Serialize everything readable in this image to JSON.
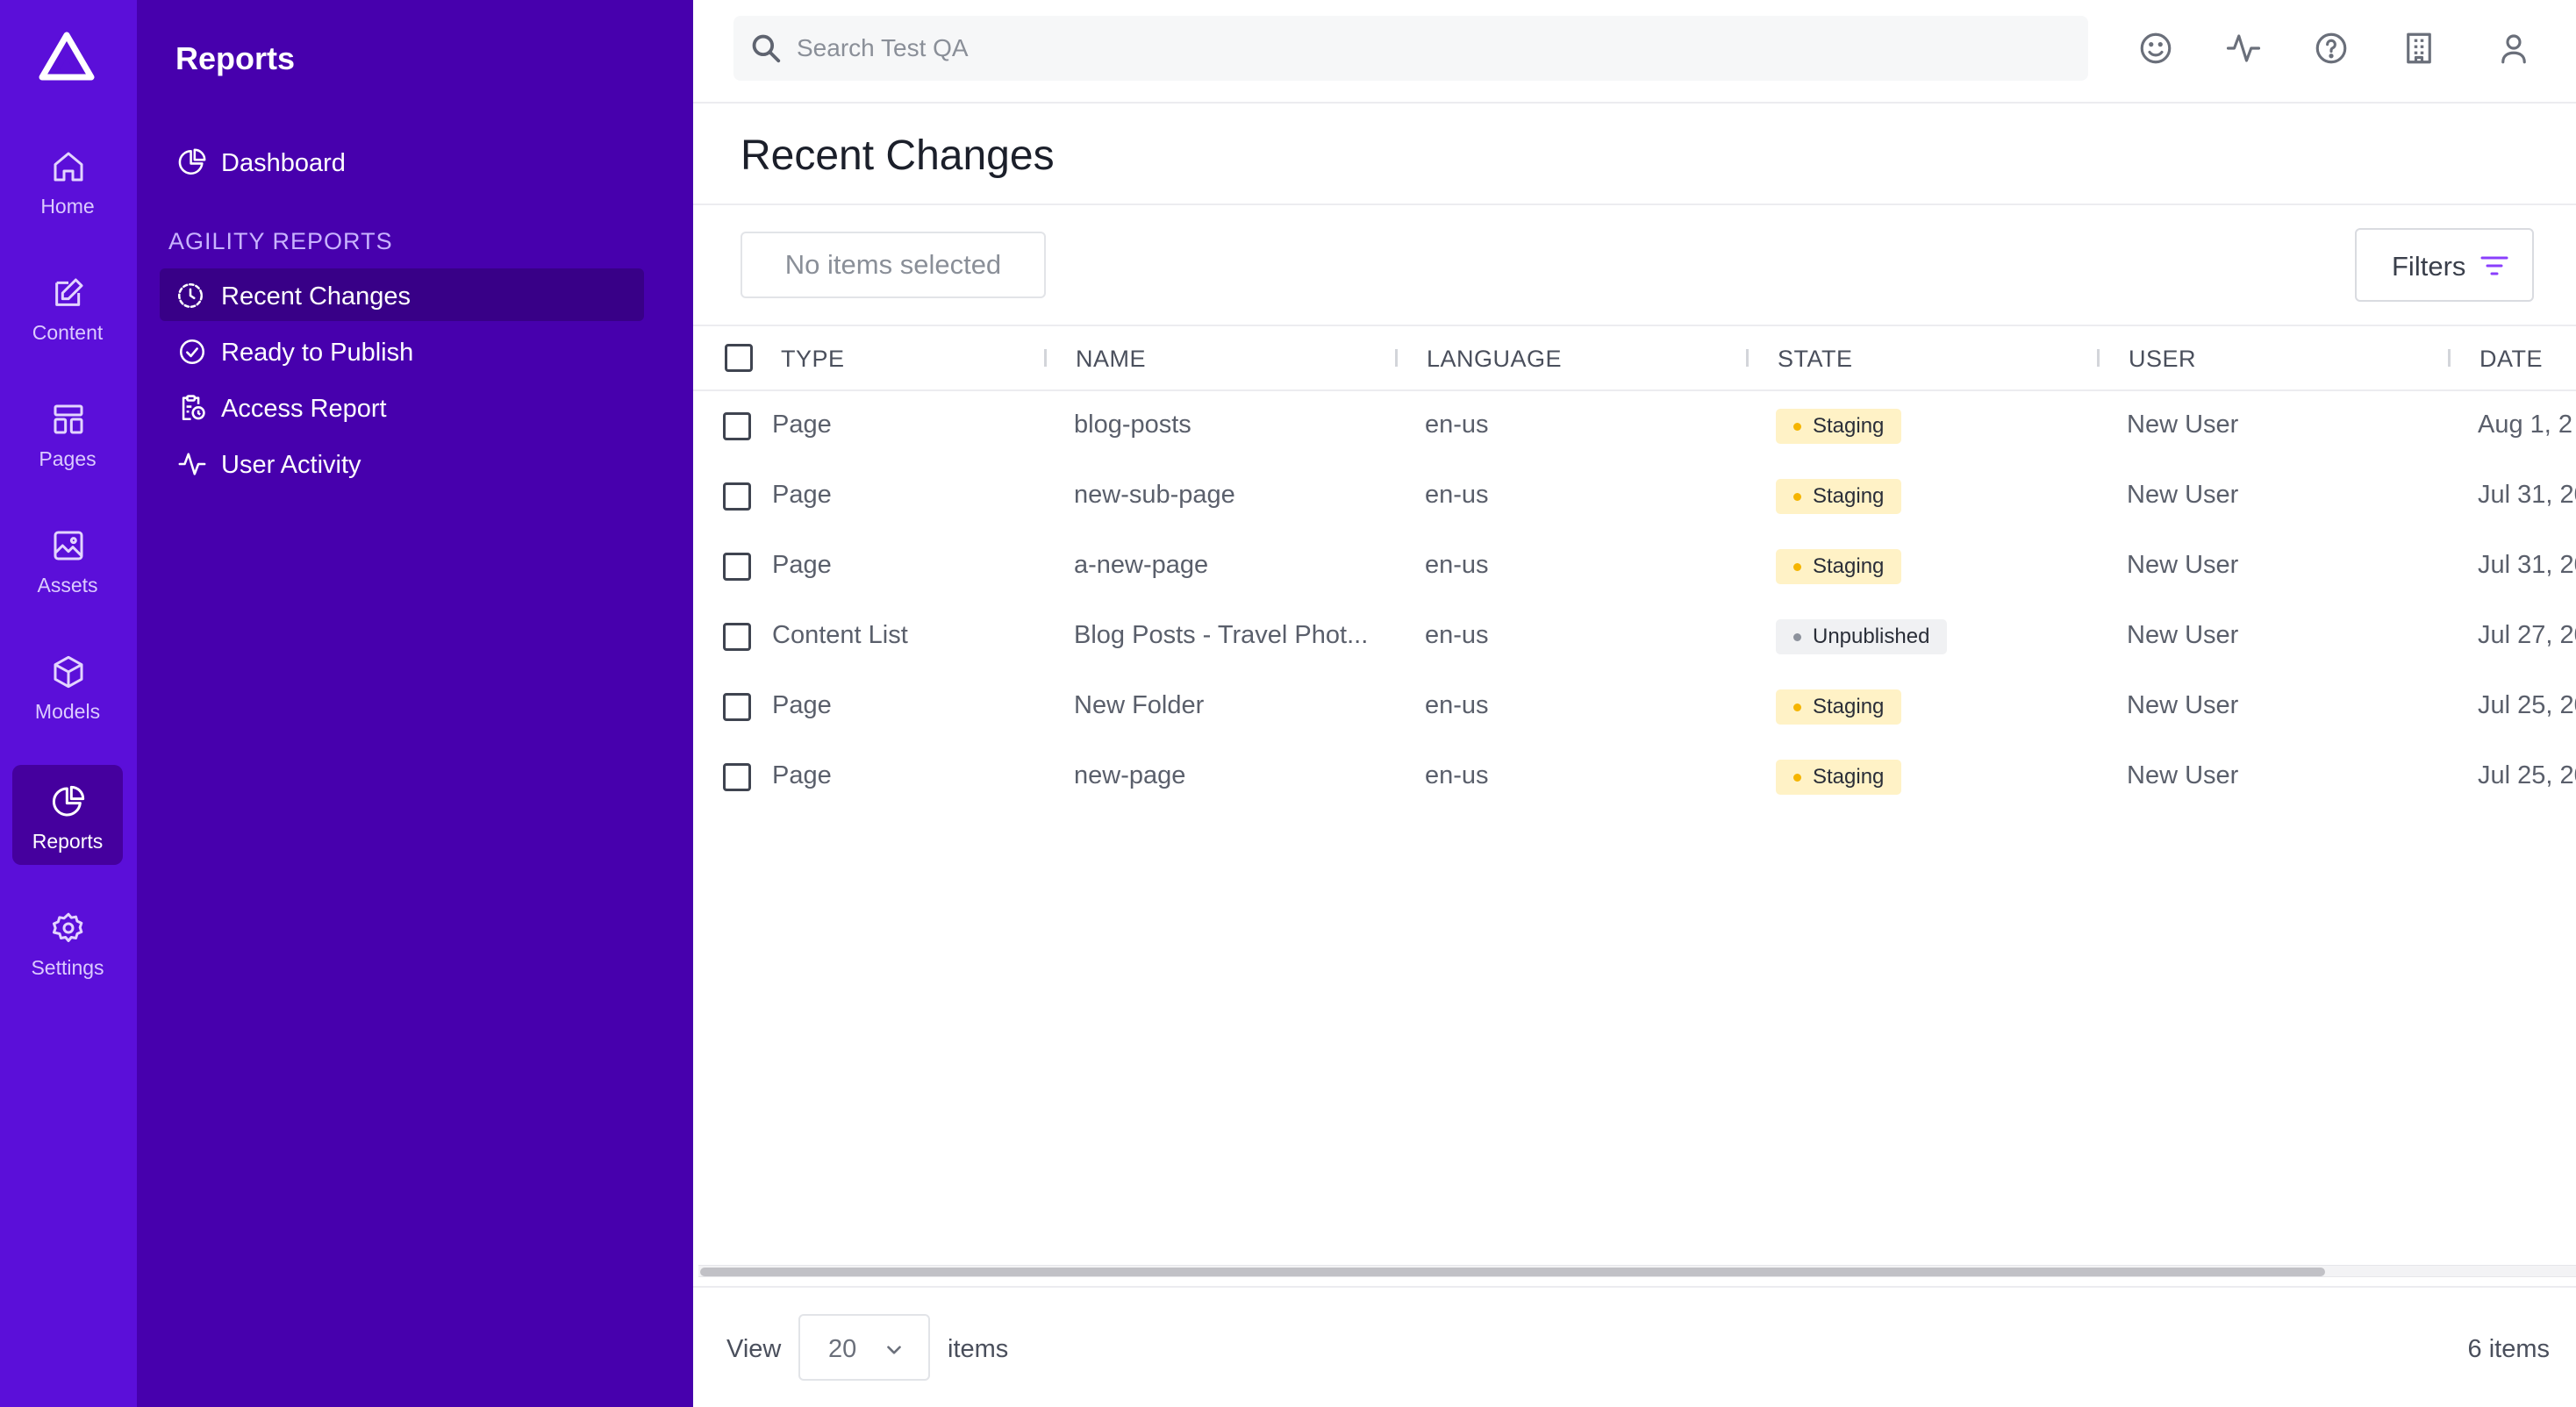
{
  "nav_rail": {
    "items": [
      {
        "label": "Home",
        "icon": "home-icon"
      },
      {
        "label": "Content",
        "icon": "edit-icon"
      },
      {
        "label": "Pages",
        "icon": "layout-icon"
      },
      {
        "label": "Assets",
        "icon": "image-icon"
      },
      {
        "label": "Models",
        "icon": "cube-icon"
      },
      {
        "label": "Reports",
        "icon": "pie-chart-icon",
        "active": true
      },
      {
        "label": "Settings",
        "icon": "gear-icon"
      }
    ]
  },
  "sidebar": {
    "title": "Reports",
    "dashboard": {
      "label": "Dashboard",
      "icon": "pie-chart-icon"
    },
    "section_label": "AGILITY REPORTS",
    "items": [
      {
        "label": "Recent Changes",
        "icon": "clock-dashed-icon",
        "active": true
      },
      {
        "label": "Ready to Publish",
        "icon": "check-circle-icon"
      },
      {
        "label": "Access Report",
        "icon": "clipboard-clock-icon"
      },
      {
        "label": "User Activity",
        "icon": "activity-icon"
      }
    ]
  },
  "topbar": {
    "search_placeholder": "Search Test QA",
    "icons": [
      "smile-icon",
      "activity-icon",
      "help-icon",
      "building-icon",
      "user-icon"
    ]
  },
  "page": {
    "title": "Recent Changes",
    "selection_text": "No items selected",
    "filters_label": "Filters"
  },
  "table": {
    "columns": [
      "TYPE",
      "NAME",
      "LANGUAGE",
      "STATE",
      "USER",
      "DATE"
    ],
    "rows": [
      {
        "type": "Page",
        "name": "blog-posts",
        "language": "en-us",
        "state": "Staging",
        "user": "New User",
        "date": "Aug 1, 2"
      },
      {
        "type": "Page",
        "name": "new-sub-page",
        "language": "en-us",
        "state": "Staging",
        "user": "New User",
        "date": "Jul 31, 20"
      },
      {
        "type": "Page",
        "name": "a-new-page",
        "language": "en-us",
        "state": "Staging",
        "user": "New User",
        "date": "Jul 31, 20"
      },
      {
        "type": "Content List",
        "name": "Blog Posts - Travel Phot...",
        "language": "en-us",
        "state": "Unpublished",
        "user": "New User",
        "date": "Jul 27, 20"
      },
      {
        "type": "Page",
        "name": "New Folder",
        "language": "en-us",
        "state": "Staging",
        "user": "New User",
        "date": "Jul 25, 20"
      },
      {
        "type": "Page",
        "name": "new-page",
        "language": "en-us",
        "state": "Staging",
        "user": "New User",
        "date": "Jul 25, 20"
      }
    ]
  },
  "footer": {
    "view_label": "View",
    "page_size": "20",
    "items_label": "items",
    "count_text": "6 items"
  },
  "colors": {
    "rail_bg": "#5b0fd9",
    "sidebar_bg": "#4700ad",
    "accent": "#8a3ffc",
    "staging_badge": "#fff2c6",
    "unpublished_badge": "#f0f1f3"
  }
}
